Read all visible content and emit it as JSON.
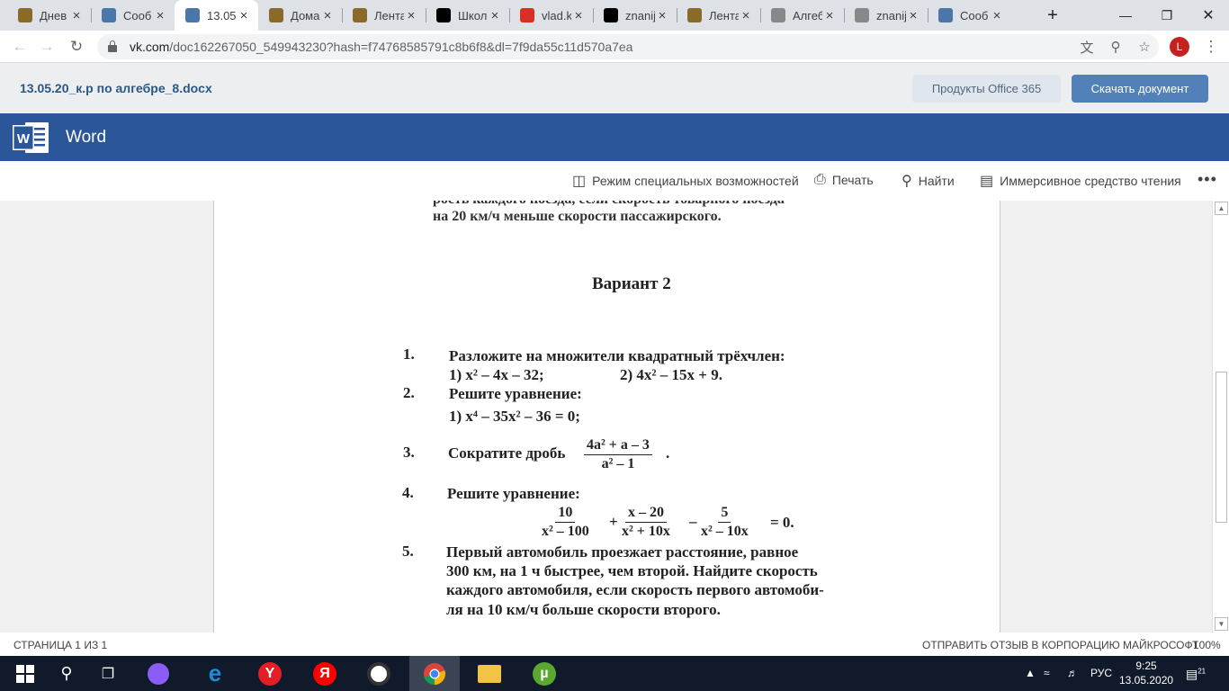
{
  "browser": {
    "tabs": [
      {
        "title": "Днев",
        "icon": "hand-icon",
        "color": "#8a6a2a"
      },
      {
        "title": "Сооб",
        "icon": "chat-icon",
        "color": "#4a76a8"
      },
      {
        "title": "13.05",
        "icon": "vk-icon",
        "color": "#4a76a8"
      },
      {
        "title": "Дома",
        "icon": "hand-icon",
        "color": "#8a6a2a"
      },
      {
        "title": "Лента",
        "icon": "hand-icon",
        "color": "#8a6a2a"
      },
      {
        "title": "Школ",
        "icon": "znanija-icon",
        "color": "#000000"
      },
      {
        "title": "vlad.k",
        "icon": "gmail-icon",
        "color": "#d93025"
      },
      {
        "title": "znanij",
        "icon": "znanija-icon",
        "color": "#000000"
      },
      {
        "title": "Лента",
        "icon": "hand-icon",
        "color": "#8a6a2a"
      },
      {
        "title": "Алгеб",
        "icon": "globe-icon",
        "color": "#888888"
      },
      {
        "title": "znanij",
        "icon": "globe-icon",
        "color": "#888888"
      },
      {
        "title": "Сооб",
        "icon": "chat-icon",
        "color": "#4a76a8"
      }
    ],
    "url_host": "vk.com",
    "url_rest": "/doc162267050_549943230?hash=f74768585791c8b6f8&dl=7f9da55c11d570a7ea",
    "profile_initial": "L"
  },
  "vk": {
    "doc_title": "13.05.20_к.р по алгебре_8.docx",
    "office_button": "Продукты Office 365",
    "download_button": "Скачать документ"
  },
  "word": {
    "app_name": "Word",
    "toolbar": {
      "accessibility": "Режим специальных возможностей",
      "print": "Печать",
      "find": "Найти",
      "immersive": "Иммерсивное средство чтения",
      "more": "•••"
    }
  },
  "document": {
    "prev_line1": "рость каждого поезда, если скорость товарного поезда",
    "prev_line2": "на 20 км/ч меньше скорости пассажирского.",
    "variant": "Вариант 2",
    "t1": {
      "num": "1.",
      "text": "Разложите на множители квадратный трёхчлен:",
      "a": "1)  x² – 4x – 32;",
      "b": "2)  4x² – 15x + 9."
    },
    "t2": {
      "num": "2.",
      "text": "Решите уравнение:",
      "a": "1)  x⁴ – 35x² – 36 = 0;"
    },
    "t3": {
      "num": "3.",
      "text": "Сократите дробь",
      "numer": "4a² + a – 3",
      "denom": "a² – 1",
      "tail": "."
    },
    "t4": {
      "num": "4.",
      "text": "Решите уравнение:",
      "f1n": "10",
      "f1d": "x² – 100",
      "op1": "+",
      "f2n": "x – 20",
      "f2d": "x² + 10x",
      "op2": "–",
      "f3n": "5",
      "f3d": "x² – 10x",
      "tail": "= 0."
    },
    "t5": {
      "num": "5.",
      "l1": "Первый  автомобиль  проезжает  расстояние,  равное",
      "l2": "300 км, на 1 ч быстрее, чем второй. Найдите скорость",
      "l3": "каждого автомобиля, если скорость первого автомоби-",
      "l4": "ля на 10 км/ч больше скорости второго."
    }
  },
  "status": {
    "page": "СТРАНИЦА 1 ИЗ 1",
    "feedback": "ОТПРАВИТЬ ОТЗЫВ В КОРПОРАЦИЮ МАЙКРОСОФТ",
    "zoom": "100%"
  },
  "taskbar": {
    "lang": "РУС",
    "time": "9:25",
    "date": "13.05.2020",
    "notification_count": "21"
  }
}
